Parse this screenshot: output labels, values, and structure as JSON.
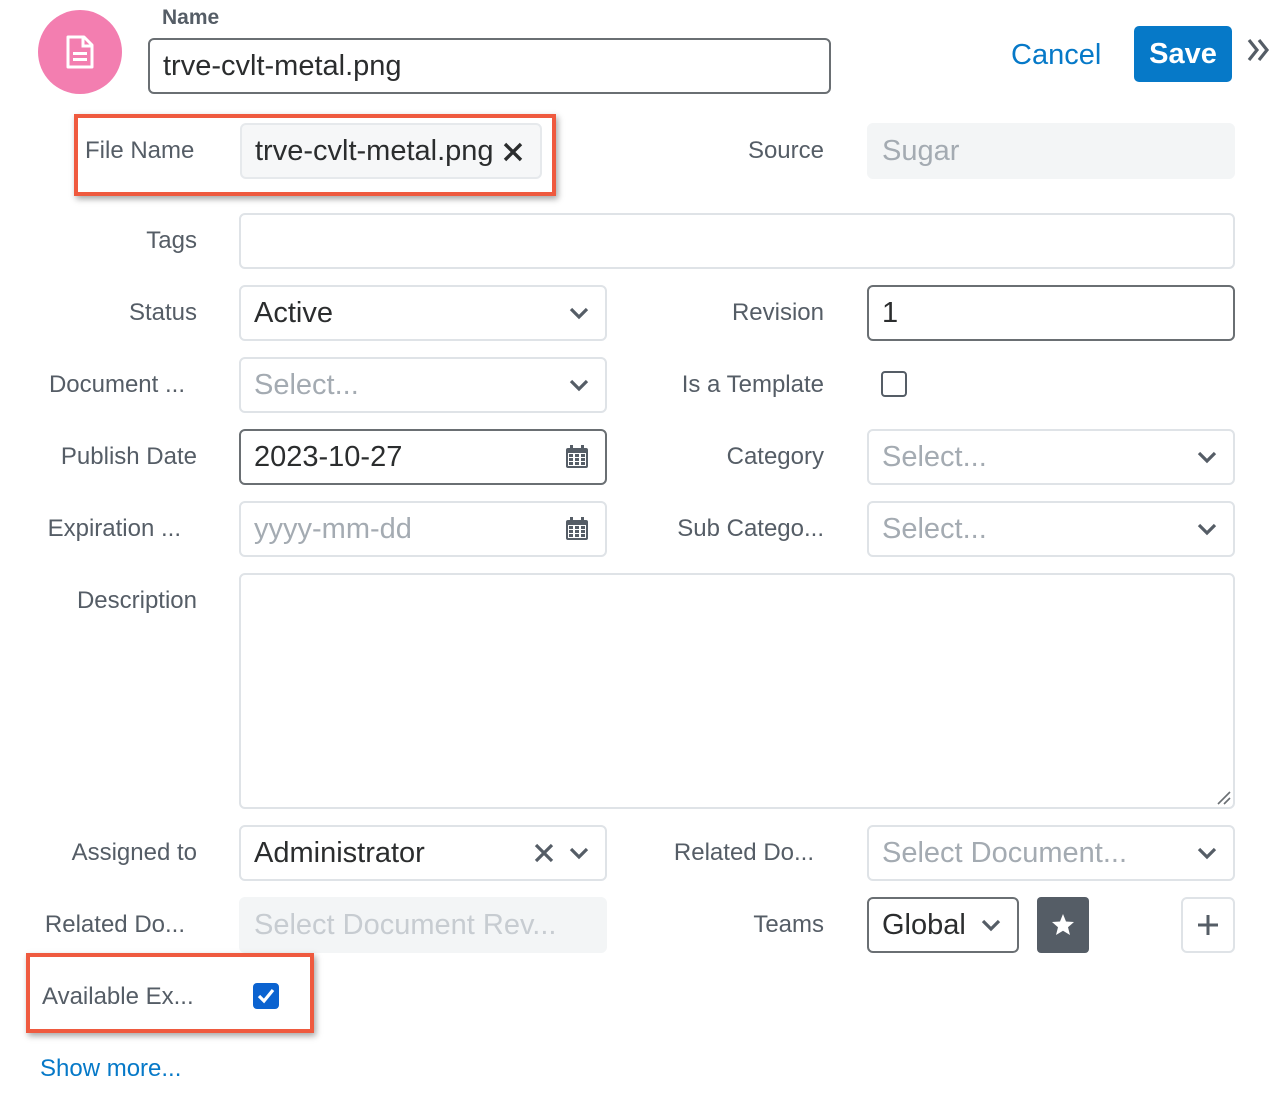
{
  "header": {
    "name_label": "Name",
    "name_value": "trve-cvlt-metal.png",
    "cancel_label": "Cancel",
    "save_label": "Save",
    "avatar_icon": "document-icon",
    "avatar_color": "#f37eb0"
  },
  "fields": {
    "file_name": {
      "label": "File Name",
      "value": "trve-cvlt-metal.png"
    },
    "source": {
      "label": "Source",
      "value": "Sugar"
    },
    "tags": {
      "label": "Tags",
      "value": ""
    },
    "status": {
      "label": "Status",
      "value": "Active"
    },
    "revision": {
      "label": "Revision",
      "value": "1"
    },
    "document_type": {
      "label": "Document ...",
      "placeholder": "Select..."
    },
    "is_template": {
      "label": "Is a Template",
      "checked": false
    },
    "publish_date": {
      "label": "Publish Date",
      "value": "2023-10-27"
    },
    "category": {
      "label": "Category",
      "placeholder": "Select..."
    },
    "expiration_date": {
      "label": "Expiration ...",
      "placeholder": "yyyy-mm-dd"
    },
    "sub_category": {
      "label": "Sub Catego...",
      "placeholder": "Select..."
    },
    "description": {
      "label": "Description",
      "value": ""
    },
    "assigned_to": {
      "label": "Assigned to",
      "value": "Administrator"
    },
    "related_document": {
      "label": "Related Do...",
      "placeholder": "Select Document..."
    },
    "related_document_revision": {
      "label": "Related Do...",
      "placeholder": "Select Document Rev..."
    },
    "teams": {
      "label": "Teams",
      "value": "Global"
    },
    "available_external": {
      "label": "Available Ex...",
      "checked": true
    }
  },
  "footer": {
    "show_more_label": "Show more..."
  },
  "colors": {
    "accent": "#0679c8",
    "highlight": "#ef5a3f",
    "checkbox": "#0b63d0"
  }
}
